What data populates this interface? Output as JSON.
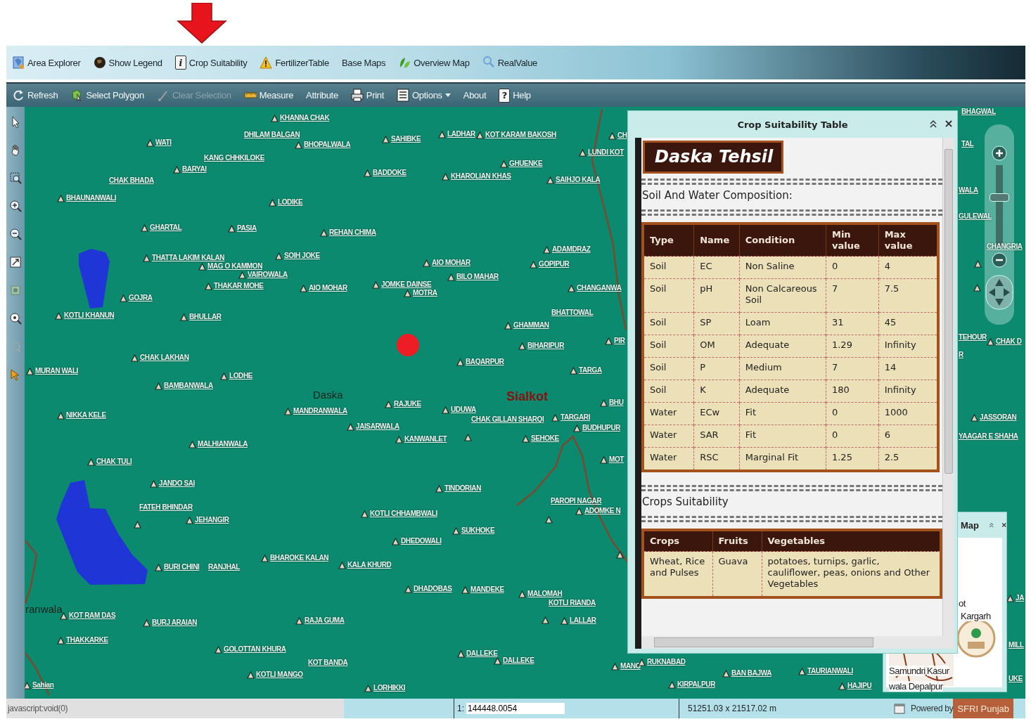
{
  "toolbar_primary": [
    {
      "label": "Area Explorer"
    },
    {
      "label": "Show Legend"
    },
    {
      "label": "Crop Suitability",
      "glyph": "i"
    },
    {
      "label": "FertilizerTable"
    },
    {
      "label": "Base Maps"
    },
    {
      "label": "Overview Map"
    },
    {
      "label": "RealValue"
    }
  ],
  "toolbar_secondary": [
    {
      "label": "Refresh",
      "disabled": false
    },
    {
      "label": "Select Polygon",
      "disabled": false
    },
    {
      "label": "Clear Selection",
      "disabled": true
    },
    {
      "label": "Measure",
      "disabled": false
    },
    {
      "label": "Attribute",
      "disabled": false
    },
    {
      "label": "Print",
      "disabled": false
    },
    {
      "label": "Options",
      "disabled": false
    },
    {
      "label": "About",
      "disabled": false
    },
    {
      "label": "Help",
      "disabled": false,
      "glyph": "?"
    }
  ],
  "map": {
    "labels": [
      {
        "text": "KHANNA CHAK",
        "kind": "village"
      },
      {
        "text": "DHILAM BALGAN",
        "kind": "area"
      },
      {
        "text": "WATI",
        "kind": "village"
      },
      {
        "text": "BHOPALWALA",
        "kind": "village"
      },
      {
        "text": "SAHIBKE",
        "kind": "village"
      },
      {
        "text": "LADHAR",
        "kind": "village"
      },
      {
        "text": "KOT KARAM BAKOSH",
        "kind": "village"
      },
      {
        "text": "CH",
        "kind": "village"
      },
      {
        "text": "KANG CHHKILOKE",
        "kind": "area"
      },
      {
        "text": "BARYAI",
        "kind": "village"
      },
      {
        "text": "BADDOKE",
        "kind": "village"
      },
      {
        "text": "GHUENKE",
        "kind": "village"
      },
      {
        "text": "KHAROLIAN KHAS",
        "kind": "village"
      },
      {
        "text": "SAIHJO KALA",
        "kind": "village"
      },
      {
        "text": "LUNDI KOT",
        "kind": "village"
      },
      {
        "text": "CHAK BHADA",
        "kind": "area"
      },
      {
        "text": "BHAUNANWALI",
        "kind": "village"
      },
      {
        "text": "LODIKE",
        "kind": "village"
      },
      {
        "text": "GHARTAL",
        "kind": "village"
      },
      {
        "text": "PASIA",
        "kind": "village"
      },
      {
        "text": "REHAN CHIMA",
        "kind": "village"
      },
      {
        "text": "ADAMDRAZ",
        "kind": "village"
      },
      {
        "text": "THATTA LAKIM KALAN",
        "kind": "village"
      },
      {
        "text": "SOIH JOKE",
        "kind": "village"
      },
      {
        "text": "MAG O KAMMON",
        "kind": "village"
      },
      {
        "text": "VAIROWALA",
        "kind": "village"
      },
      {
        "text": "AIO MOHAR",
        "kind": "village"
      },
      {
        "text": "GOPIPUR",
        "kind": "village"
      },
      {
        "text": "BILO MAHAR",
        "kind": "village"
      },
      {
        "text": "THAKAR MOHE",
        "kind": "village"
      },
      {
        "text": "AIO MOHAR",
        "kind": "village"
      },
      {
        "text": "JOMKE DAINSE",
        "kind": "village"
      },
      {
        "text": "MOTRA",
        "kind": "village"
      },
      {
        "text": "CHANGANWA",
        "kind": "village"
      },
      {
        "text": "GOJRA",
        "kind": "village"
      },
      {
        "text": "KOTLI KHANUN",
        "kind": "village"
      },
      {
        "text": "BHULLAR",
        "kind": "village"
      },
      {
        "text": "BHATTOWAL",
        "kind": "area"
      },
      {
        "text": "GHAMMAN",
        "kind": "village"
      },
      {
        "text": "BIHARIPUR",
        "kind": "village"
      },
      {
        "text": "PIR",
        "kind": "village"
      },
      {
        "text": "CHAK LAKHAN",
        "kind": "village"
      },
      {
        "text": "BAQARPUR",
        "kind": "village"
      },
      {
        "text": "TARGA",
        "kind": "village"
      },
      {
        "text": "MURAN WALI",
        "kind": "village"
      },
      {
        "text": "LODHE",
        "kind": "village"
      },
      {
        "text": "BAMBANWALA",
        "kind": "village"
      },
      {
        "text": "Daska",
        "kind": "town"
      },
      {
        "text": "Sialkot",
        "kind": "city"
      },
      {
        "text": "MANDRANWALA",
        "kind": "village"
      },
      {
        "text": "RAJUKE",
        "kind": "village"
      },
      {
        "text": "UDUWA",
        "kind": "village"
      },
      {
        "text": "BHU",
        "kind": "village"
      },
      {
        "text": "NIKKA KELE",
        "kind": "village"
      },
      {
        "text": "CHAK GILLAN SHARQI",
        "kind": "area"
      },
      {
        "text": "TARGARI",
        "kind": "village"
      },
      {
        "text": "BUDHUPUR",
        "kind": "village"
      },
      {
        "text": "JAISARWALA",
        "kind": "village"
      },
      {
        "text": "KANWANLET",
        "kind": "village"
      },
      {
        "text": "SEHOKE",
        "kind": "village"
      },
      {
        "text": "MALHIANWALA",
        "kind": "village"
      },
      {
        "text": "MOT",
        "kind": "village"
      },
      {
        "text": "CHAK TULI",
        "kind": "village"
      },
      {
        "text": "JANDO SAI",
        "kind": "village"
      },
      {
        "text": "TINDORIAN",
        "kind": "village"
      },
      {
        "text": "FATEH BHINDAR",
        "kind": "area"
      },
      {
        "text": "PAROPI NAGAR",
        "kind": "area"
      },
      {
        "text": "ADOMKE N",
        "kind": "village"
      },
      {
        "text": "JEHANGIR",
        "kind": "village"
      },
      {
        "text": "KOTLI CHHAMBWALI",
        "kind": "village"
      },
      {
        "text": "SUKHOKE",
        "kind": "village"
      },
      {
        "text": "DHEDOWALI",
        "kind": "village"
      },
      {
        "text": "BURI CHINI",
        "kind": "village"
      },
      {
        "text": "RANJHAL",
        "kind": "area"
      },
      {
        "text": "BHAROKE KALAN",
        "kind": "village"
      },
      {
        "text": "KALA KHURD",
        "kind": "village"
      },
      {
        "text": "DHADOBAS",
        "kind": "village"
      },
      {
        "text": "MANDEKE",
        "kind": "village"
      },
      {
        "text": "MALOMAH",
        "kind": "village"
      },
      {
        "text": "KOTLI RIANDA",
        "kind": "area"
      },
      {
        "text": "ranwala",
        "kind": "town"
      },
      {
        "text": "KOT RAM DAS",
        "kind": "village"
      },
      {
        "text": "BURJ ARAIAN",
        "kind": "village"
      },
      {
        "text": "RAJA GUMA",
        "kind": "village"
      },
      {
        "text": "LALLAR",
        "kind": "village"
      },
      {
        "text": "THAKKARKE",
        "kind": "village"
      },
      {
        "text": "GOLOTTAN KHURA",
        "kind": "village"
      },
      {
        "text": "KOT BANDA",
        "kind": "area"
      },
      {
        "text": "DALLEKE",
        "kind": "village"
      },
      {
        "text": "DALLEKE",
        "kind": "village"
      },
      {
        "text": "KOTLI MANGO",
        "kind": "village"
      },
      {
        "text": "MANG",
        "kind": "village"
      },
      {
        "text": "RUKNABAD",
        "kind": "village"
      },
      {
        "text": "BAN BAJWA",
        "kind": "village"
      },
      {
        "text": "TAURIANWALI",
        "kind": "village"
      },
      {
        "text": "Sahian",
        "kind": "village"
      },
      {
        "text": "LORHIKKI",
        "kind": "village"
      },
      {
        "text": "KIRPALPUR",
        "kind": "village"
      },
      {
        "text": "HAJIPU",
        "kind": "village"
      },
      {
        "text": "BHAGWAL",
        "kind": "area"
      },
      {
        "text": "TAL",
        "kind": "area"
      },
      {
        "text": "WALA",
        "kind": "area"
      },
      {
        "text": "GULEWAL",
        "kind": "area"
      },
      {
        "text": "CHANGRIA",
        "kind": "area"
      },
      {
        "text": "TEHOUR",
        "kind": "area"
      },
      {
        "text": "CHAK D",
        "kind": "village"
      },
      {
        "text": "R",
        "kind": "area"
      },
      {
        "text": "JASSORAN",
        "kind": "village"
      },
      {
        "text": "YAAGAR E SHAHA",
        "kind": "area"
      },
      {
        "text": "JA",
        "kind": "village"
      },
      {
        "text": "MILL",
        "kind": "area"
      },
      {
        "text": "UKE",
        "kind": "area"
      }
    ],
    "zoom_slider": {
      "level": 0.62
    }
  },
  "crop_window": {
    "title": "Crop Suitability Table",
    "heading": "Daska Tehsil",
    "soil_section": "Soil And Water Composition:",
    "soil_table": {
      "columns": [
        "Type",
        "Name",
        "Condition",
        "Min value",
        "Max value"
      ],
      "rows": [
        [
          "Soil",
          "EC",
          "Non Saline",
          "0",
          "4"
        ],
        [
          "Soil",
          "pH",
          "Non Calcareous Soil",
          "7",
          "7.5"
        ],
        [
          "Soil",
          "SP",
          "Loam",
          "31",
          "45"
        ],
        [
          "Soil",
          "OM",
          "Adequate",
          "1.29",
          "Infinity"
        ],
        [
          "Soil",
          "P",
          "Medium",
          "7",
          "14"
        ],
        [
          "Soil",
          "K",
          "Adequate",
          "180",
          "Infinity"
        ],
        [
          "Water",
          "ECw",
          "Fit",
          "0",
          "1000"
        ],
        [
          "Water",
          "SAR",
          "Fit",
          "0",
          "6"
        ],
        [
          "Water",
          "RSC",
          "Marginal Fit",
          "1.25",
          "2.5"
        ]
      ]
    },
    "crops_section": "Crops Suitability",
    "crops_table": {
      "columns": [
        "Crops",
        "Fruits",
        "Vegetables"
      ],
      "rows": [
        [
          "Wheat, Rice and Pulses",
          "Guava",
          "potatoes, turnips, garlic, cauliflower, peas, onions and Other Vegetables"
        ]
      ]
    }
  },
  "overview_window": {
    "title": "Map",
    "places": [
      "ot",
      "Kargarh",
      "Samundri",
      "Kasur",
      "wala Depalpur"
    ]
  },
  "status_bar": {
    "url": "javascript:void(0)",
    "scale_prefix": "1:",
    "scale_value": "144448.0054",
    "extent": "51251.03 x 21517.02 m",
    "powered_by": "Powered by",
    "brand": "SFRI Punjab"
  }
}
